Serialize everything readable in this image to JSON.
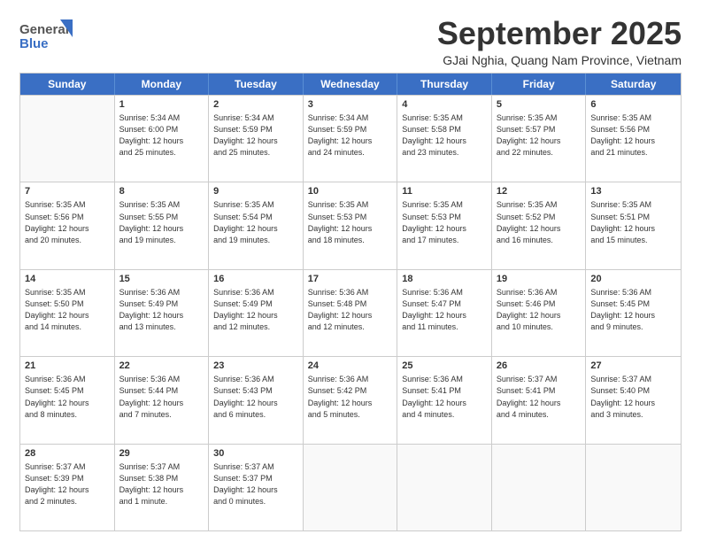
{
  "header": {
    "logo_line1": "General",
    "logo_line2": "Blue",
    "month": "September 2025",
    "location": "GJai Nghia, Quang Nam Province, Vietnam"
  },
  "weekdays": [
    "Sunday",
    "Monday",
    "Tuesday",
    "Wednesday",
    "Thursday",
    "Friday",
    "Saturday"
  ],
  "weeks": [
    [
      {
        "day": "",
        "info": ""
      },
      {
        "day": "1",
        "info": "Sunrise: 5:34 AM\nSunset: 6:00 PM\nDaylight: 12 hours\nand 25 minutes."
      },
      {
        "day": "2",
        "info": "Sunrise: 5:34 AM\nSunset: 5:59 PM\nDaylight: 12 hours\nand 25 minutes."
      },
      {
        "day": "3",
        "info": "Sunrise: 5:34 AM\nSunset: 5:59 PM\nDaylight: 12 hours\nand 24 minutes."
      },
      {
        "day": "4",
        "info": "Sunrise: 5:35 AM\nSunset: 5:58 PM\nDaylight: 12 hours\nand 23 minutes."
      },
      {
        "day": "5",
        "info": "Sunrise: 5:35 AM\nSunset: 5:57 PM\nDaylight: 12 hours\nand 22 minutes."
      },
      {
        "day": "6",
        "info": "Sunrise: 5:35 AM\nSunset: 5:56 PM\nDaylight: 12 hours\nand 21 minutes."
      }
    ],
    [
      {
        "day": "7",
        "info": "Sunrise: 5:35 AM\nSunset: 5:56 PM\nDaylight: 12 hours\nand 20 minutes."
      },
      {
        "day": "8",
        "info": "Sunrise: 5:35 AM\nSunset: 5:55 PM\nDaylight: 12 hours\nand 19 minutes."
      },
      {
        "day": "9",
        "info": "Sunrise: 5:35 AM\nSunset: 5:54 PM\nDaylight: 12 hours\nand 19 minutes."
      },
      {
        "day": "10",
        "info": "Sunrise: 5:35 AM\nSunset: 5:53 PM\nDaylight: 12 hours\nand 18 minutes."
      },
      {
        "day": "11",
        "info": "Sunrise: 5:35 AM\nSunset: 5:53 PM\nDaylight: 12 hours\nand 17 minutes."
      },
      {
        "day": "12",
        "info": "Sunrise: 5:35 AM\nSunset: 5:52 PM\nDaylight: 12 hours\nand 16 minutes."
      },
      {
        "day": "13",
        "info": "Sunrise: 5:35 AM\nSunset: 5:51 PM\nDaylight: 12 hours\nand 15 minutes."
      }
    ],
    [
      {
        "day": "14",
        "info": "Sunrise: 5:35 AM\nSunset: 5:50 PM\nDaylight: 12 hours\nand 14 minutes."
      },
      {
        "day": "15",
        "info": "Sunrise: 5:36 AM\nSunset: 5:49 PM\nDaylight: 12 hours\nand 13 minutes."
      },
      {
        "day": "16",
        "info": "Sunrise: 5:36 AM\nSunset: 5:49 PM\nDaylight: 12 hours\nand 12 minutes."
      },
      {
        "day": "17",
        "info": "Sunrise: 5:36 AM\nSunset: 5:48 PM\nDaylight: 12 hours\nand 12 minutes."
      },
      {
        "day": "18",
        "info": "Sunrise: 5:36 AM\nSunset: 5:47 PM\nDaylight: 12 hours\nand 11 minutes."
      },
      {
        "day": "19",
        "info": "Sunrise: 5:36 AM\nSunset: 5:46 PM\nDaylight: 12 hours\nand 10 minutes."
      },
      {
        "day": "20",
        "info": "Sunrise: 5:36 AM\nSunset: 5:45 PM\nDaylight: 12 hours\nand 9 minutes."
      }
    ],
    [
      {
        "day": "21",
        "info": "Sunrise: 5:36 AM\nSunset: 5:45 PM\nDaylight: 12 hours\nand 8 minutes."
      },
      {
        "day": "22",
        "info": "Sunrise: 5:36 AM\nSunset: 5:44 PM\nDaylight: 12 hours\nand 7 minutes."
      },
      {
        "day": "23",
        "info": "Sunrise: 5:36 AM\nSunset: 5:43 PM\nDaylight: 12 hours\nand 6 minutes."
      },
      {
        "day": "24",
        "info": "Sunrise: 5:36 AM\nSunset: 5:42 PM\nDaylight: 12 hours\nand 5 minutes."
      },
      {
        "day": "25",
        "info": "Sunrise: 5:36 AM\nSunset: 5:41 PM\nDaylight: 12 hours\nand 4 minutes."
      },
      {
        "day": "26",
        "info": "Sunrise: 5:37 AM\nSunset: 5:41 PM\nDaylight: 12 hours\nand 4 minutes."
      },
      {
        "day": "27",
        "info": "Sunrise: 5:37 AM\nSunset: 5:40 PM\nDaylight: 12 hours\nand 3 minutes."
      }
    ],
    [
      {
        "day": "28",
        "info": "Sunrise: 5:37 AM\nSunset: 5:39 PM\nDaylight: 12 hours\nand 2 minutes."
      },
      {
        "day": "29",
        "info": "Sunrise: 5:37 AM\nSunset: 5:38 PM\nDaylight: 12 hours\nand 1 minute."
      },
      {
        "day": "30",
        "info": "Sunrise: 5:37 AM\nSunset: 5:37 PM\nDaylight: 12 hours\nand 0 minutes."
      },
      {
        "day": "",
        "info": ""
      },
      {
        "day": "",
        "info": ""
      },
      {
        "day": "",
        "info": ""
      },
      {
        "day": "",
        "info": ""
      }
    ]
  ]
}
